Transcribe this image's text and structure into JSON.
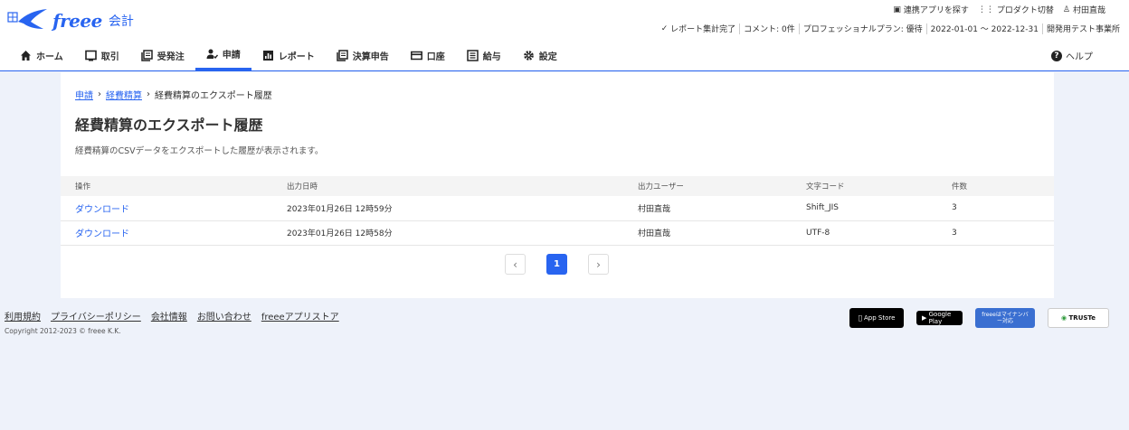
{
  "header": {
    "logo_text": "freee",
    "logo_sub": "会計",
    "top_links": [
      {
        "label": "連携アプリを探す",
        "icon": "store-icon"
      },
      {
        "label": "プロダクト切替",
        "icon": "grid-icon"
      },
      {
        "label": "村田直哉",
        "icon": "user-icon"
      }
    ],
    "status": {
      "report": "レポート集計完了",
      "comment": "コメント: 0件",
      "plan": "プロフェッショナルプラン: 優待",
      "period": "2022-01-01 ～ 2022-12-31",
      "office": "開発用テスト事業所"
    },
    "nav": [
      {
        "label": "ホーム",
        "icon": "home-icon"
      },
      {
        "label": "取引",
        "icon": "monitor-icon"
      },
      {
        "label": "受発注",
        "icon": "docs-icon"
      },
      {
        "label": "申請",
        "icon": "approval-icon"
      },
      {
        "label": "レポート",
        "icon": "chart-icon"
      },
      {
        "label": "決算申告",
        "icon": "docs-icon"
      },
      {
        "label": "口座",
        "icon": "card-icon"
      },
      {
        "label": "給与",
        "icon": "list-icon"
      },
      {
        "label": "設定",
        "icon": "gear-icon"
      }
    ],
    "help": "ヘルプ"
  },
  "main": {
    "breadcrumb": [
      "申請",
      "経費精算",
      "経費精算のエクスポート履歴"
    ],
    "title": "経費精算のエクスポート履歴",
    "description": "経費精算のCSVデータをエクスポートした履歴が表示されます。",
    "columns": [
      "操作",
      "出力日時",
      "出力ユーザー",
      "文字コード",
      "件数"
    ],
    "rows": [
      {
        "action": "ダウンロード",
        "date": "2023年01月26日 12時59分",
        "user": "村田直哉",
        "encoding": "Shift_JIS",
        "count": "3"
      },
      {
        "action": "ダウンロード",
        "date": "2023年01月26日 12時58分",
        "user": "村田直哉",
        "encoding": "UTF-8",
        "count": "3"
      }
    ],
    "pager": {
      "prev": "‹",
      "current": "1",
      "next": "›"
    }
  },
  "footer": {
    "links": [
      "利用規約",
      "プライバシーポリシー",
      "会社情報",
      "お問い合わせ",
      "freeeアプリストア"
    ],
    "copyright": "Copyright 2012-2023 © freee K.K.",
    "badges": [
      "App Store",
      "Google Play",
      "freeeはマイナンバー対応",
      "TRUSTe"
    ]
  },
  "colors": {
    "accent": "#2864f0",
    "background": "#eef2fa"
  }
}
